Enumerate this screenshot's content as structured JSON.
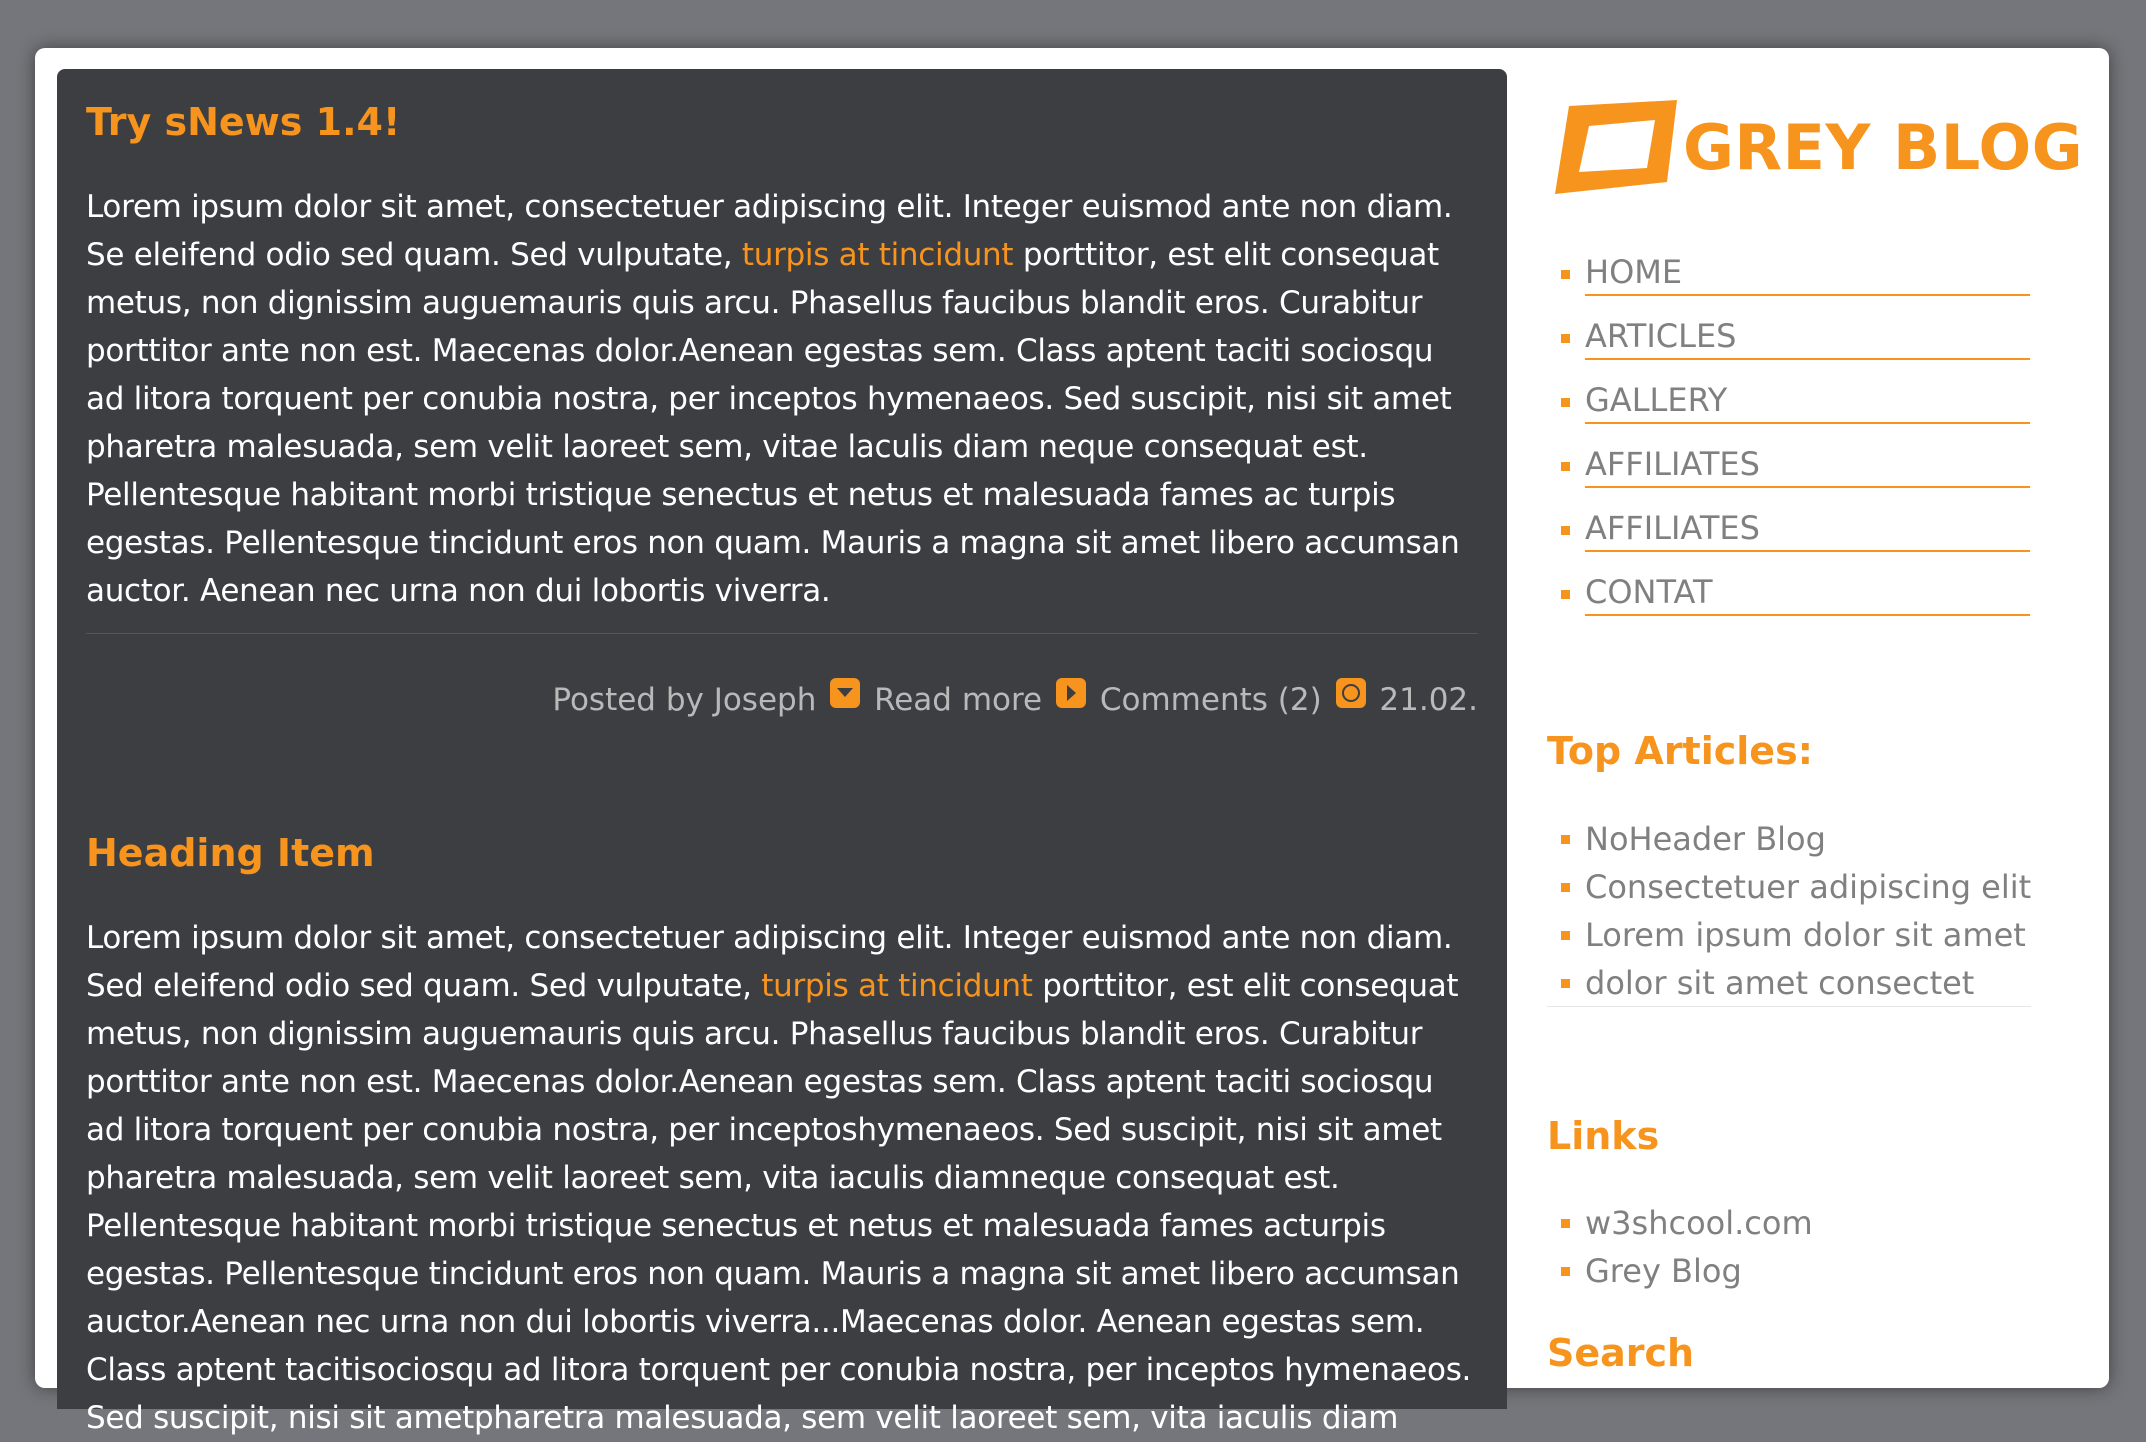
{
  "posts": [
    {
      "title": "Try sNews 1.4!",
      "body_pre": "Lorem ipsum dolor sit amet, consectetuer adipiscing elit. Integer euismod ante non diam. Se eleifend odio sed quam. Sed vulputate, ",
      "body_link": "turpis at tincidunt",
      "body_post": " porttitor, est elit consequat metus, non dignissim auguemauris quis arcu. Phasellus faucibus blandit eros. Curabitur porttitor ante non est. Maecenas dolor.Aenean egestas sem. Class aptent taciti sociosqu ad litora torquent per conubia nostra, per inceptos hymenaeos. Sed suscipit, nisi sit amet pharetra malesuada, sem velit laoreet sem, vitae laculis diam neque consequat est. Pellentesque habitant morbi tristique senectus et netus et malesuada fames ac turpis egestas. Pellentesque tincidunt eros non quam. Mauris a magna sit amet libero accumsan auctor. Aenean nec urna non dui lobortis viverra.",
      "meta": {
        "posted_by": "Posted by Joseph",
        "read_more": "Read more",
        "comments": "Comments (2)",
        "date": "21.02."
      }
    },
    {
      "title": "Heading Item",
      "body_pre": "Lorem ipsum dolor sit amet, consectetuer adipiscing elit. Integer euismod ante non diam. Sed eleifend odio sed quam. Sed vulputate, ",
      "body_link": "turpis at tincidunt",
      "body_post": " porttitor, est elit consequat metus, non dignissim auguemauris quis arcu. Phasellus faucibus blandit eros. Curabitur porttitor ante non est. Maecenas dolor.Aenean egestas sem. Class aptent taciti sociosqu ad litora torquent per conubia nostra, per inceptoshymenaeos. Sed suscipit, nisi sit amet pharetra malesuada, sem velit laoreet sem, vita iaculis diamneque consequat est. Pellentesque habitant morbi tristique senectus et netus et malesuada fames acturpis egestas. Pellentesque tincidunt eros non quam. Mauris a magna sit amet libero accumsan auctor.Aenean nec urna non dui lobortis viverra...Maecenas dolor. Aenean egestas sem. Class aptent tacitisociosqu ad litora torquent per conubia nostra, per inceptos hymenaeos. Sed suscipit, nisi sit ametpharetra malesuada, sem velit laoreet sem, vita iaculis diam"
    }
  ],
  "sidebar": {
    "logo_text": "GREY BLOG",
    "nav": [
      "HOME",
      "ARTICLES",
      "GALLERY",
      "AFFILIATES",
      "AFFILIATES",
      "CONTAT"
    ],
    "top_articles": {
      "heading": "Top Articles:",
      "items": [
        "NoHeader Blog",
        "Consectetuer adipiscing elit",
        "Lorem ipsum dolor sit amet",
        "dolor sit amet consectet"
      ]
    },
    "links": {
      "heading": "Links",
      "items": [
        "w3shcool.com",
        "Grey Blog"
      ]
    },
    "search": {
      "heading": "Search"
    }
  },
  "colors": {
    "accent": "#f7941d",
    "content_bg": "#3d3e42",
    "outer_bg": "#75767b",
    "muted_text": "#808080"
  },
  "icons": {
    "read_more": "chevron-down-icon",
    "comments": "play-icon",
    "date": "clock-icon"
  }
}
